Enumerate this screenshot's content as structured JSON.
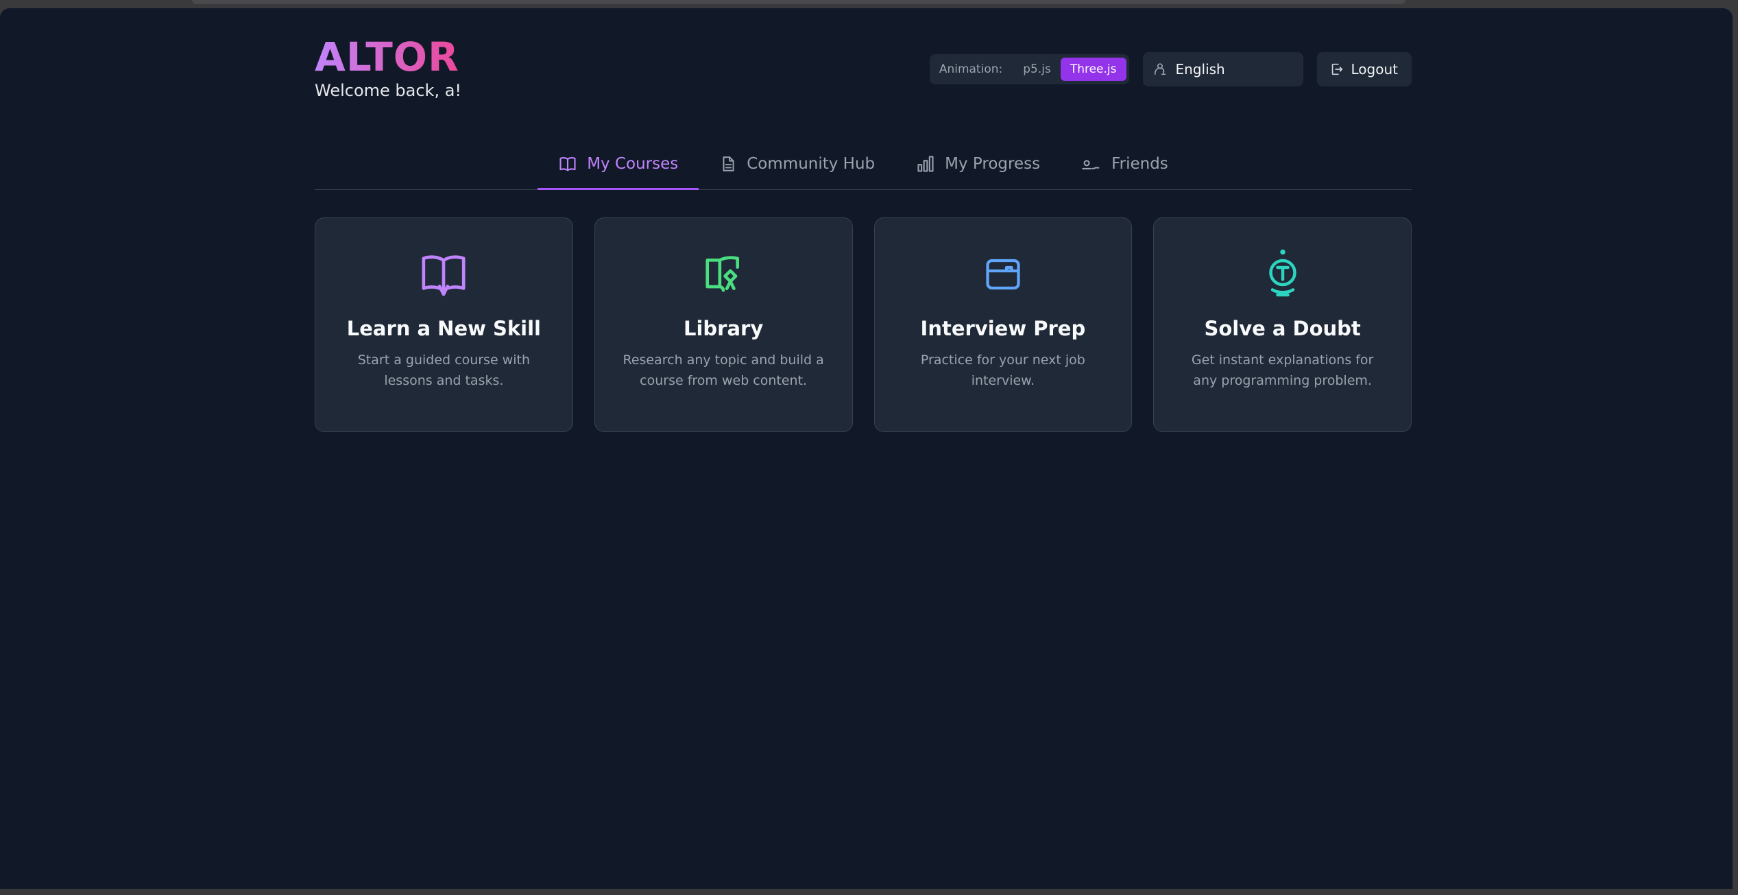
{
  "app": {
    "logo": "ALTOR",
    "welcome": "Welcome back, a!"
  },
  "controls": {
    "animation_label": "Animation:",
    "animation_options": [
      "p5.js",
      "Three.js"
    ],
    "animation_selected": "Three.js",
    "language": "English",
    "logout_label": "Logout"
  },
  "tabs": [
    {
      "label": "My Courses",
      "icon": "book-open-icon",
      "active": true
    },
    {
      "label": "Community Hub",
      "icon": "document-icon",
      "active": false
    },
    {
      "label": "My Progress",
      "icon": "bar-chart-icon",
      "active": false
    },
    {
      "label": "Friends",
      "icon": "friends-icon",
      "active": false
    }
  ],
  "cards": [
    {
      "title": "Learn a New Skill",
      "description": "Start a guided course with lessons and tasks.",
      "icon": "book-icon",
      "color": "#c084fc"
    },
    {
      "title": "Library",
      "description": "Research any topic and build a course from web content.",
      "icon": "library-book-icon",
      "color": "#4ade80"
    },
    {
      "title": "Interview Prep",
      "description": "Practice for your next job interview.",
      "icon": "briefcase-icon",
      "color": "#60a5fa"
    },
    {
      "title": "Solve a Doubt",
      "description": "Get instant explanations for any programming problem.",
      "icon": "lightbulb-icon",
      "color": "#2dd4bf"
    }
  ]
}
